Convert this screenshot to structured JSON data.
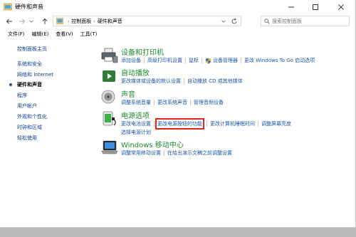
{
  "window": {
    "title": "硬件和声音"
  },
  "address": {
    "crumbs": [
      "控制面板",
      "硬件和声音"
    ]
  },
  "search": {
    "placeholder": "搜索控制面板"
  },
  "menu": [
    "文件(F)",
    "编辑(E)",
    "查看(V)",
    "工具(T)"
  ],
  "sidebar": {
    "home": "控制面板主页",
    "items": [
      {
        "label": "系统和安全",
        "active": false
      },
      {
        "label": "网络和 Internet",
        "active": false
      },
      {
        "label": "硬件和声音",
        "active": true
      },
      {
        "label": "程序",
        "active": false
      },
      {
        "label": "用户帐户",
        "active": false
      },
      {
        "label": "外观和个性化",
        "active": false
      },
      {
        "label": "时钟和区域",
        "active": false
      },
      {
        "label": "轻松使用",
        "active": false
      }
    ]
  },
  "categories": [
    {
      "title": "设备和打印机",
      "icon": "printer-icon",
      "rows": [
        [
          "添加设备",
          "高级打印机设置",
          "鼠标",
          "设备管理器",
          "更改 Windows To Go 启动选项"
        ]
      ]
    },
    {
      "title": "自动播放",
      "icon": "autoplay-icon",
      "rows": [
        [
          "更改媒体或设备的默认设置",
          "自动播放 CD 或其他媒体"
        ]
      ]
    },
    {
      "title": "声音",
      "icon": "speaker-icon",
      "rows": [
        [
          "调整系统音量",
          "更改系统声音",
          "管理音频设备"
        ]
      ]
    },
    {
      "title": "电源选项",
      "icon": "power-options-icon",
      "rows": [
        [
          "更改电池设置",
          "更改电源按钮的功能",
          "更改计算机睡眠时间",
          "调整屏幕亮度"
        ],
        [
          "选择电源计划"
        ]
      ]
    },
    {
      "title": "Windows 移动中心",
      "icon": "mobility-center-icon",
      "rows": [
        [
          "调整常用移动设置",
          "在给出演示文稿之前调整设置"
        ]
      ]
    }
  ],
  "highlight": "更改电源按钮的功能",
  "colors": {
    "category_title": "#1d8a2e",
    "link": "#1a56a8",
    "highlight_border": "#e8231b"
  }
}
